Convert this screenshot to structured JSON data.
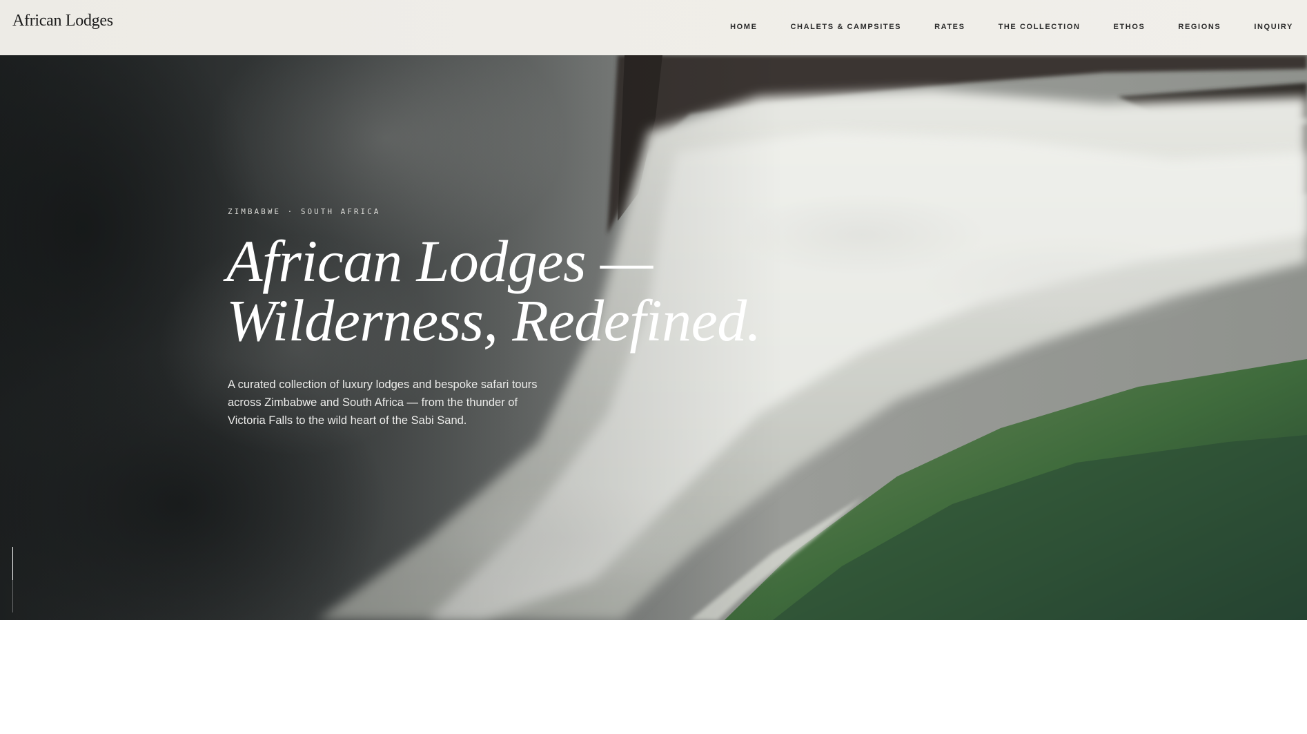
{
  "header": {
    "logo": "African Lodges",
    "nav": [
      {
        "label": "HOME"
      },
      {
        "label": "CHALETS & CAMPSITES"
      },
      {
        "label": "RATES"
      },
      {
        "label": "THE COLLECTION"
      },
      {
        "label": "ETHOS"
      },
      {
        "label": "REGIONS"
      },
      {
        "label": "INQUIRY"
      }
    ]
  },
  "hero": {
    "eyebrow": "ZIMBABWE · SOUTH AFRICA",
    "headline_line1": "African Lodges —",
    "headline_line2": "Wilderness, Redefined.",
    "lede": "A curated collection of luxury lodges and bespoke safari tours across Zimbabwe and South Africa — from the thunder of Victoria Falls to the wild heart of the Sabi Sand.",
    "background_image": "victoria-falls-waterfall-photo",
    "scroll_progress": 0.5
  },
  "colors": {
    "header_bg": "#efede8",
    "nav_text": "#2a2a2a",
    "headline": "#ffffff",
    "water_green": "#3f6b3c",
    "mist": "#c9cbc6"
  }
}
